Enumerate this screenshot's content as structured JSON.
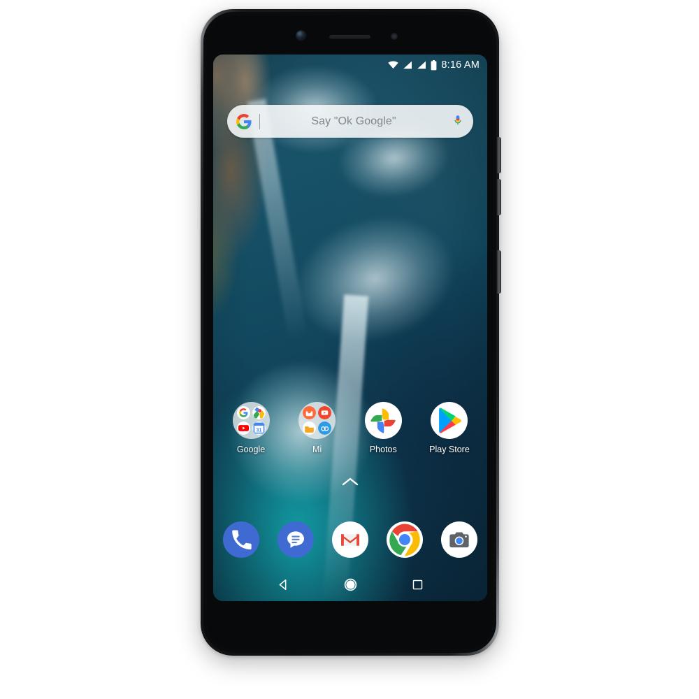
{
  "device": {
    "name": "Xiaomi Mi A2 smartphone",
    "body_color": "#15171a",
    "screen_bg": "#12394b"
  },
  "status_bar": {
    "time": "8:16 AM",
    "icons": [
      "wifi-icon",
      "signal-sim1-icon",
      "signal-sim2-icon",
      "battery-icon"
    ]
  },
  "search": {
    "placeholder": "Say \"Ok Google\"",
    "value": "",
    "logo": "google-g-logo",
    "mic": "microphone-icon"
  },
  "home_screen": {
    "apps": [
      {
        "label": "Google",
        "icon": "google-folder-icon",
        "type": "folder",
        "children": [
          "google-search-icon",
          "google-maps-icon",
          "youtube-icon",
          "google-calendar-icon"
        ]
      },
      {
        "label": "Mi",
        "icon": "mi-folder-icon",
        "type": "folder",
        "children": [
          "mi-browser-icon",
          "mi-video-icon",
          "mi-file-manager-icon",
          "mi-drop-icon"
        ]
      },
      {
        "label": "Photos",
        "icon": "google-photos-icon",
        "type": "app",
        "children": []
      },
      {
        "label": "Play Store",
        "icon": "google-play-store-icon",
        "type": "app",
        "children": []
      }
    ],
    "drawer_handle": "chevron-up-icon"
  },
  "dock": {
    "apps": [
      {
        "label": "Phone",
        "icon": "phone-icon",
        "color": "#3f6ad1"
      },
      {
        "label": "Messages",
        "icon": "messages-icon",
        "color": "#3f6ad1"
      },
      {
        "label": "Gmail",
        "icon": "gmail-icon",
        "color": "#ffffff"
      },
      {
        "label": "Chrome",
        "icon": "chrome-icon",
        "color": "#ffffff"
      },
      {
        "label": "Camera",
        "icon": "camera-icon",
        "color": "#ffffff"
      }
    ]
  },
  "nav_bar": {
    "buttons": [
      {
        "label": "Back",
        "icon": "back-triangle-icon"
      },
      {
        "label": "Home",
        "icon": "home-circle-icon"
      },
      {
        "label": "Recents",
        "icon": "recents-square-icon"
      }
    ]
  },
  "hardware": {
    "front_camera": "front-camera-lens",
    "earpiece": "earpiece-speaker",
    "proximity_sensor": "proximity-sensor",
    "volume_up": "volume-up-key",
    "volume_down": "volume-down-key",
    "power": "power-key"
  },
  "colors": {
    "google_blue": "#4285F4",
    "google_red": "#EA4335",
    "google_yellow": "#FBBC05",
    "google_green": "#34A853",
    "dock_blue": "#3f6ad1",
    "gmail_red": "#E7493B",
    "page_bg": "#ffffff"
  }
}
